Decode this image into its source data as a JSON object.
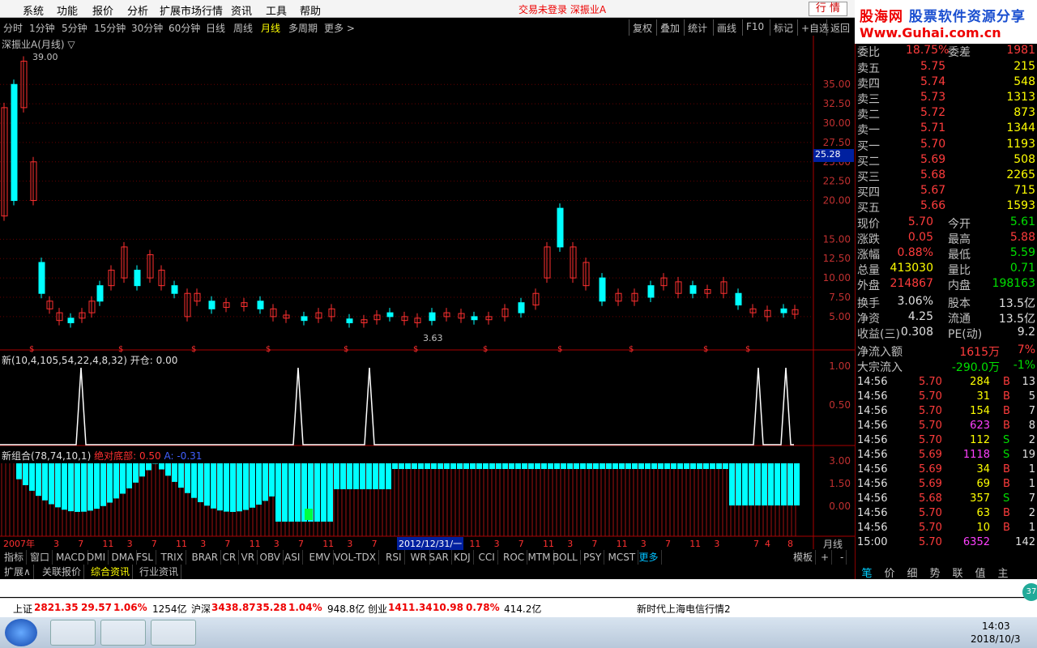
{
  "menu": {
    "items": [
      "系统",
      "功能",
      "报价",
      "分析",
      "扩展市场行情",
      "资讯",
      "工具",
      "帮助"
    ],
    "status": "交易未登录  深振业A",
    "hq_button": "行 情"
  },
  "logo": {
    "line1a": "股海网",
    "line1b": "股票软件资源分享",
    "line2": "Www.Guhai.com.cn"
  },
  "periods": {
    "items": [
      "分时",
      "1分钟",
      "5分钟",
      "15分钟",
      "30分钟",
      "60分钟",
      "日线",
      "周线",
      "月线",
      "多周期",
      "更多 >"
    ],
    "active": "月线"
  },
  "toolbar": [
    "复权",
    "叠加",
    "统计",
    "画线",
    "F10",
    "标记",
    "+自选",
    "返回"
  ],
  "chart": {
    "title": "深振业A(月线) ▽",
    "high_label": "39.00",
    "low_label": "3.63",
    "cursor_price": "25.28",
    "price_axis": [
      "35.00",
      "32.50",
      "30.00",
      "27.50",
      "25.00",
      "22.50",
      "20.00",
      "15.00",
      "12.50",
      "10.00",
      "7.50",
      "5.00"
    ],
    "ind1_title": "新(10,4,105,54,22,4,8,32)  开仓: 0.00",
    "ind1_axis": [
      "1.00",
      "0.50"
    ],
    "ind2_title": "新组合(78,74,10,1)",
    "ind2_red": "绝对底部: 0.50",
    "ind2_blue": "A: -0.31",
    "ind2_axis": [
      "3.00",
      "1.50",
      "0.00"
    ],
    "x_labels": [
      "2007年",
      "3",
      "7",
      "11",
      "3",
      "7",
      "11",
      "3",
      "7",
      "11",
      "3",
      "7",
      "11",
      "3",
      "7",
      "11",
      "3",
      "7",
      "11",
      "3",
      "7",
      "11",
      "3",
      "7",
      "11",
      "3",
      "7",
      "11",
      "3",
      "7",
      "4",
      "8"
    ],
    "x_highlight": "2012/12/31/一",
    "x_right": "月线"
  },
  "chart_data": {
    "type": "candlestick",
    "title": "深振业A(月线)",
    "price_marks": {
      "high": 39.0,
      "low": 3.63,
      "cursor": 25.28
    },
    "ylim": [
      3,
      39
    ]
  },
  "quote": {
    "weibi": {
      "label": "委比",
      "value": "18.75%",
      "label2": "委差",
      "value2": "1981"
    },
    "asks": [
      {
        "label": "卖五",
        "price": "5.75",
        "vol": "215"
      },
      {
        "label": "卖四",
        "price": "5.74",
        "vol": "548"
      },
      {
        "label": "卖三",
        "price": "5.73",
        "vol": "1313"
      },
      {
        "label": "卖二",
        "price": "5.72",
        "vol": "873"
      },
      {
        "label": "卖一",
        "price": "5.71",
        "vol": "1344"
      }
    ],
    "bids": [
      {
        "label": "买一",
        "price": "5.70",
        "vol": "1193"
      },
      {
        "label": "买二",
        "price": "5.69",
        "vol": "508"
      },
      {
        "label": "买三",
        "price": "5.68",
        "vol": "2265"
      },
      {
        "label": "买四",
        "price": "5.67",
        "vol": "715"
      },
      {
        "label": "买五",
        "price": "5.66",
        "vol": "1593"
      }
    ],
    "stats": [
      {
        "l1": "现价",
        "v1": "5.70",
        "c1": "red",
        "l2": "今开",
        "v2": "5.61",
        "c2": "grn"
      },
      {
        "l1": "涨跌",
        "v1": "0.05",
        "c1": "red",
        "l2": "最高",
        "v2": "5.88",
        "c2": "red"
      },
      {
        "l1": "涨幅",
        "v1": "0.88%",
        "c1": "red",
        "l2": "最低",
        "v2": "5.59",
        "c2": "grn"
      },
      {
        "l1": "总量",
        "v1": "413030",
        "c1": "yel",
        "l2": "量比",
        "v2": "0.71",
        "c2": "grn"
      },
      {
        "l1": "外盘",
        "v1": "214867",
        "c1": "red",
        "l2": "内盘",
        "v2": "198163",
        "c2": "grn"
      }
    ],
    "stats2": [
      {
        "l1": "换手",
        "v1": "3.06%",
        "l2": "股本",
        "v2": "13.5亿"
      },
      {
        "l1": "净资",
        "v1": "4.25",
        "l2": "流通",
        "v2": "13.5亿"
      },
      {
        "l1": "收益(三)",
        "v1": "0.308",
        "l2": "PE(动)",
        "v2": "9.2"
      }
    ],
    "flow": [
      {
        "label": "净流入额",
        "value": "1615万",
        "pct": "7%",
        "color": "red"
      },
      {
        "label": "大宗流入",
        "value": "-290.0万",
        "pct": "-1%",
        "color": "grn"
      }
    ],
    "ticks": [
      {
        "t": "14:56",
        "p": "5.70",
        "v": "284",
        "s": "B",
        "n": "13",
        "vc": "yel"
      },
      {
        "t": "14:56",
        "p": "5.70",
        "v": "31",
        "s": "B",
        "n": "5",
        "vc": "yel"
      },
      {
        "t": "14:56",
        "p": "5.70",
        "v": "154",
        "s": "B",
        "n": "7",
        "vc": "yel"
      },
      {
        "t": "14:56",
        "p": "5.70",
        "v": "623",
        "s": "B",
        "n": "8",
        "vc": "mag"
      },
      {
        "t": "14:56",
        "p": "5.70",
        "v": "112",
        "s": "S",
        "n": "2",
        "vc": "yel"
      },
      {
        "t": "14:56",
        "p": "5.69",
        "v": "1118",
        "s": "S",
        "n": "19",
        "vc": "mag"
      },
      {
        "t": "14:56",
        "p": "5.69",
        "v": "34",
        "s": "B",
        "n": "1",
        "vc": "yel"
      },
      {
        "t": "14:56",
        "p": "5.69",
        "v": "69",
        "s": "B",
        "n": "1",
        "vc": "yel"
      },
      {
        "t": "14:56",
        "p": "5.68",
        "v": "357",
        "s": "S",
        "n": "7",
        "vc": "yel"
      },
      {
        "t": "14:56",
        "p": "5.70",
        "v": "63",
        "s": "B",
        "n": "2",
        "vc": "yel"
      },
      {
        "t": "14:56",
        "p": "5.70",
        "v": "10",
        "s": "B",
        "n": "1",
        "vc": "yel"
      },
      {
        "t": "15:00",
        "p": "5.70",
        "v": "6352",
        "s": "",
        "n": "142",
        "vc": "mag"
      }
    ],
    "tabs": [
      "笔",
      "价",
      "细",
      "势",
      "联",
      "值",
      "主"
    ]
  },
  "indicator_tabs": [
    "指标",
    "窗口",
    "MACD",
    "DMI",
    "DMA",
    "FSL",
    "TRIX",
    "BRAR",
    "CR",
    "VR",
    "OBV",
    "ASI",
    "EMV",
    "VOL-TDX",
    "RSI",
    "WR",
    "SAR",
    "KDJ",
    "CCI",
    "ROC",
    "MTM",
    "BOLL",
    "PSY",
    "MCST",
    "更多"
  ],
  "indicator_right": [
    "模板",
    "+",
    "-"
  ],
  "info_tabs": [
    "扩展∧",
    "关联报价",
    "综合资讯",
    "行业资讯"
  ],
  "index_bar": {
    "sh": {
      "name": "上证",
      "val": "2821.35",
      "chg": "29.57",
      "pct": "1.06%",
      "amt": "1254亿"
    },
    "sz": {
      "name": "沪深",
      "val": "3438.87",
      "chg": "35.28",
      "pct": "1.04%",
      "amt": "948.8亿"
    },
    "cy": {
      "name": "创业",
      "val": "1411.34",
      "chg": "10.98",
      "pct": "0.78%",
      "amt": "414.2亿"
    },
    "feed": "新时代上海电信行情2"
  },
  "taskbar": {
    "time": "14:03",
    "date": "2018/10/3",
    "badge": "37"
  }
}
